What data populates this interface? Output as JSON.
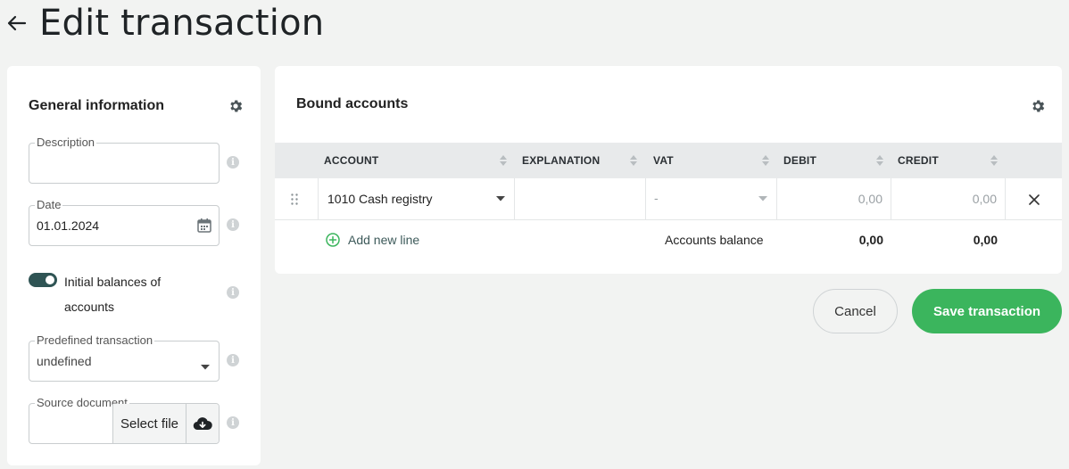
{
  "page": {
    "title": "Edit transaction"
  },
  "general": {
    "title": "General information",
    "description": {
      "label": "Description",
      "value": ""
    },
    "date": {
      "label": "Date",
      "value": "01.01.2024"
    },
    "initial_balances": {
      "label": "Initial balances of accounts",
      "checked": true
    },
    "predefined": {
      "label": "Predefined transaction",
      "value": "undefined"
    },
    "source": {
      "label": "Source document",
      "button": "Select file"
    }
  },
  "bound": {
    "title": "Bound accounts",
    "columns": [
      "ACCOUNT",
      "EXPLANATION",
      "VAT",
      "DEBIT",
      "CREDIT"
    ],
    "rows": [
      {
        "account": "1010 Cash registry",
        "explanation": "",
        "vat": "-",
        "debit": "0,00",
        "credit": "0,00"
      }
    ],
    "add_line": "Add new line",
    "balance_label": "Accounts balance",
    "balance_debit": "0,00",
    "balance_credit": "0,00"
  },
  "actions": {
    "cancel": "Cancel",
    "save": "Save transaction"
  },
  "colors": {
    "accent_green": "#3bb55d",
    "toggle_on": "#2f5454"
  }
}
